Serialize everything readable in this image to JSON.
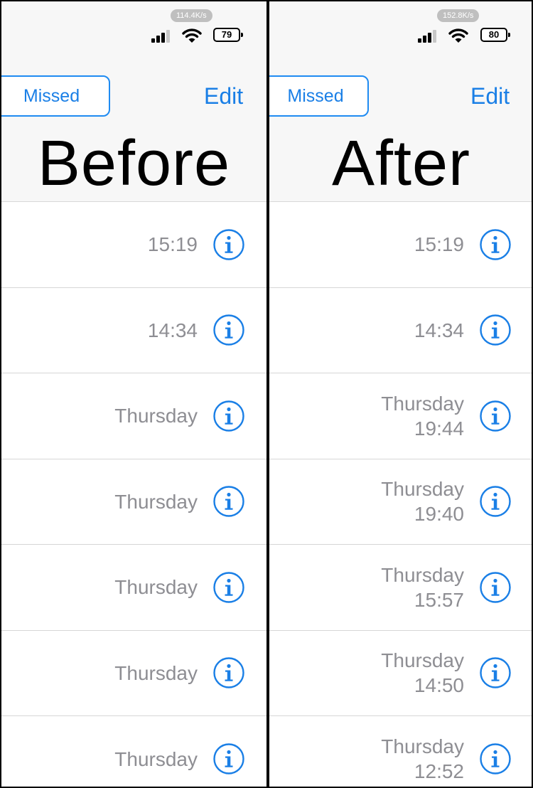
{
  "before": {
    "status": {
      "speed": "114.4K/s",
      "battery": "79"
    },
    "header": {
      "segment_label": "Missed",
      "edit_label": "Edit",
      "overlay_label": "Before"
    },
    "rows": [
      {
        "line1": "15:19",
        "line2": ""
      },
      {
        "line1": "14:34",
        "line2": ""
      },
      {
        "line1": "Thursday",
        "line2": ""
      },
      {
        "line1": "Thursday",
        "line2": ""
      },
      {
        "line1": "Thursday",
        "line2": ""
      },
      {
        "line1": "Thursday",
        "line2": ""
      },
      {
        "line1": "Thursday",
        "line2": ""
      }
    ]
  },
  "after": {
    "status": {
      "speed": "152.8K/s",
      "battery": "80"
    },
    "header": {
      "segment_label": "Missed",
      "edit_label": "Edit",
      "overlay_label": "After"
    },
    "rows": [
      {
        "line1": "15:19",
        "line2": ""
      },
      {
        "line1": "14:34",
        "line2": ""
      },
      {
        "line1": "Thursday",
        "line2": "19:44"
      },
      {
        "line1": "Thursday",
        "line2": "19:40"
      },
      {
        "line1": "Thursday",
        "line2": "15:57"
      },
      {
        "line1": "Thursday",
        "line2": "14:50"
      },
      {
        "line1": "Thursday",
        "line2": "12:52"
      }
    ]
  },
  "icons": {
    "signal": "cellular-signal-icon",
    "wifi": "wifi-icon",
    "battery": "battery-icon",
    "info": "info-circle-icon"
  },
  "colors": {
    "accent": "#1a7fe6",
    "secondary_text": "#8e8e93",
    "header_bg": "#f7f7f7"
  }
}
